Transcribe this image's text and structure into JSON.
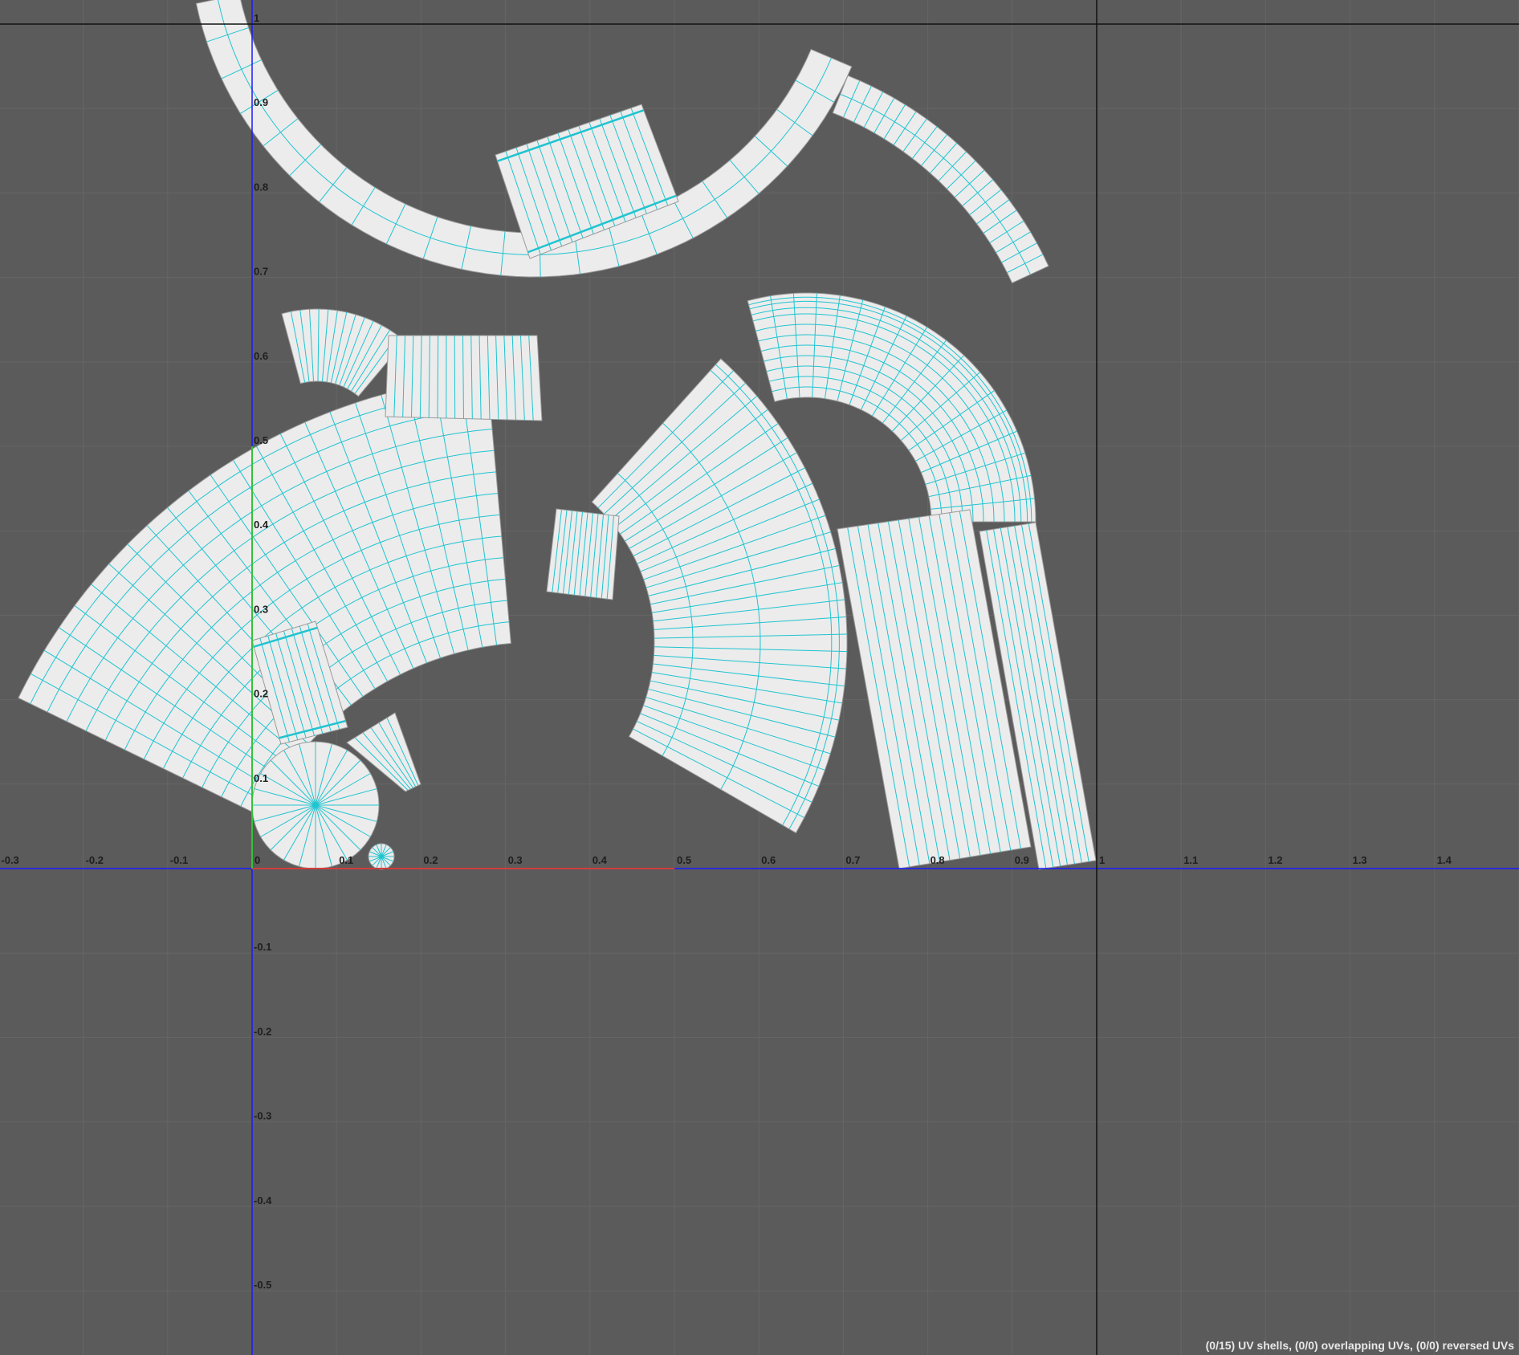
{
  "viewport": {
    "background": "#5b5b5b",
    "u_ticks": [
      "-0.3",
      "-0.2",
      "-0.1",
      "0",
      "0.1",
      "0.2",
      "0.3",
      "0.4",
      "0.5",
      "0.6",
      "0.7",
      "0.8",
      "0.9",
      "1",
      "1.1",
      "1.2",
      "1.3",
      "1.4"
    ],
    "v_ticks": [
      "-0.5",
      "-0.4",
      "-0.3",
      "-0.2",
      "-0.1",
      "0.1",
      "0.2",
      "0.3",
      "0.4",
      "0.5",
      "0.6",
      "0.7",
      "0.8",
      "0.9",
      "1"
    ]
  },
  "uv": {
    "shell_fill": "#ececec",
    "edge_color": "#1fc4d0",
    "u_axis_color": "#d23c3c",
    "v_axis_color": "#36c236",
    "shell_count": 15
  },
  "status": {
    "text": "(0/15) UV shells, (0/0) overlapping UVs, (0/0) reversed UVs"
  }
}
